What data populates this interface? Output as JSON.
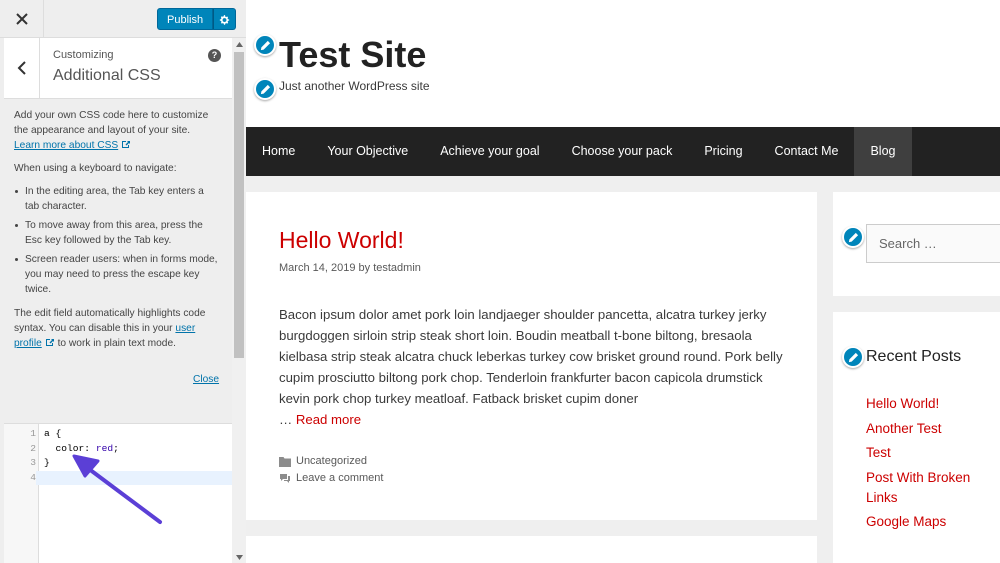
{
  "customizer": {
    "publish_label": "Publish",
    "section": {
      "supertitle": "Customizing",
      "title": "Additional CSS",
      "help_label": "?"
    },
    "description": {
      "intro": "Add your own CSS code here to customize the appearance and layout of your site.",
      "learn_more": "Learn more about CSS",
      "keyboard_heading": "When using a keyboard to navigate:",
      "bullets": [
        "In the editing area, the Tab key enters a tab character.",
        "To move away from this area, press the Esc key followed by the Tab key.",
        "Screen reader users: when in forms mode, you may need to press the escape key twice."
      ],
      "highlight_text": "The edit field automatically highlights code syntax. You can disable this in your",
      "user_profile": "user profile",
      "plain_text": "to work in plain text mode.",
      "close_link": "Close"
    },
    "editor": {
      "line_numbers": [
        "1",
        "2",
        "3",
        "4"
      ],
      "line1": "a {",
      "line2_prop": "  color: ",
      "line2_val": "red",
      "line2_end": ";",
      "line3": "}",
      "line4": ""
    },
    "colors": {
      "publish": "#0085ba",
      "annotation_arrow": "#5b3fd6"
    }
  },
  "site": {
    "title": "Test Site",
    "tagline": "Just another WordPress site",
    "nav": [
      "Home",
      "Your Objective",
      "Achieve your goal",
      "Choose your pack",
      "Pricing",
      "Contact Me",
      "Blog"
    ],
    "nav_current": "Blog",
    "post": {
      "title": "Hello World!",
      "date": "March 14, 2019",
      "by": "by",
      "author": "testadmin",
      "body": "Bacon ipsum dolor amet pork loin landjaeger shoulder pancetta, alcatra turkey jerky burgdoggen sirloin strip steak short loin. Boudin meatball t-bone biltong, bresaola kielbasa strip steak alcatra chuck leberkas turkey cow brisket ground round. Pork belly cupim prosciutto biltong pork chop. Tenderloin frankfurter bacon capicola drumstick kevin pork chop turkey meatloaf. Fatback brisket cupim doner",
      "ellipsis": "…",
      "read_more": "Read more",
      "category": "Uncategorized",
      "comment": "Leave a comment"
    },
    "search_placeholder": "Search …",
    "recent_posts_title": "Recent Posts",
    "recent_posts": [
      "Hello World!",
      "Another Test",
      "Test",
      "Post With Broken Links",
      "Google Maps"
    ],
    "colors": {
      "link_red": "#cc0000",
      "nav_bg": "#222222",
      "nav_current_bg": "#3f3f3f"
    }
  }
}
